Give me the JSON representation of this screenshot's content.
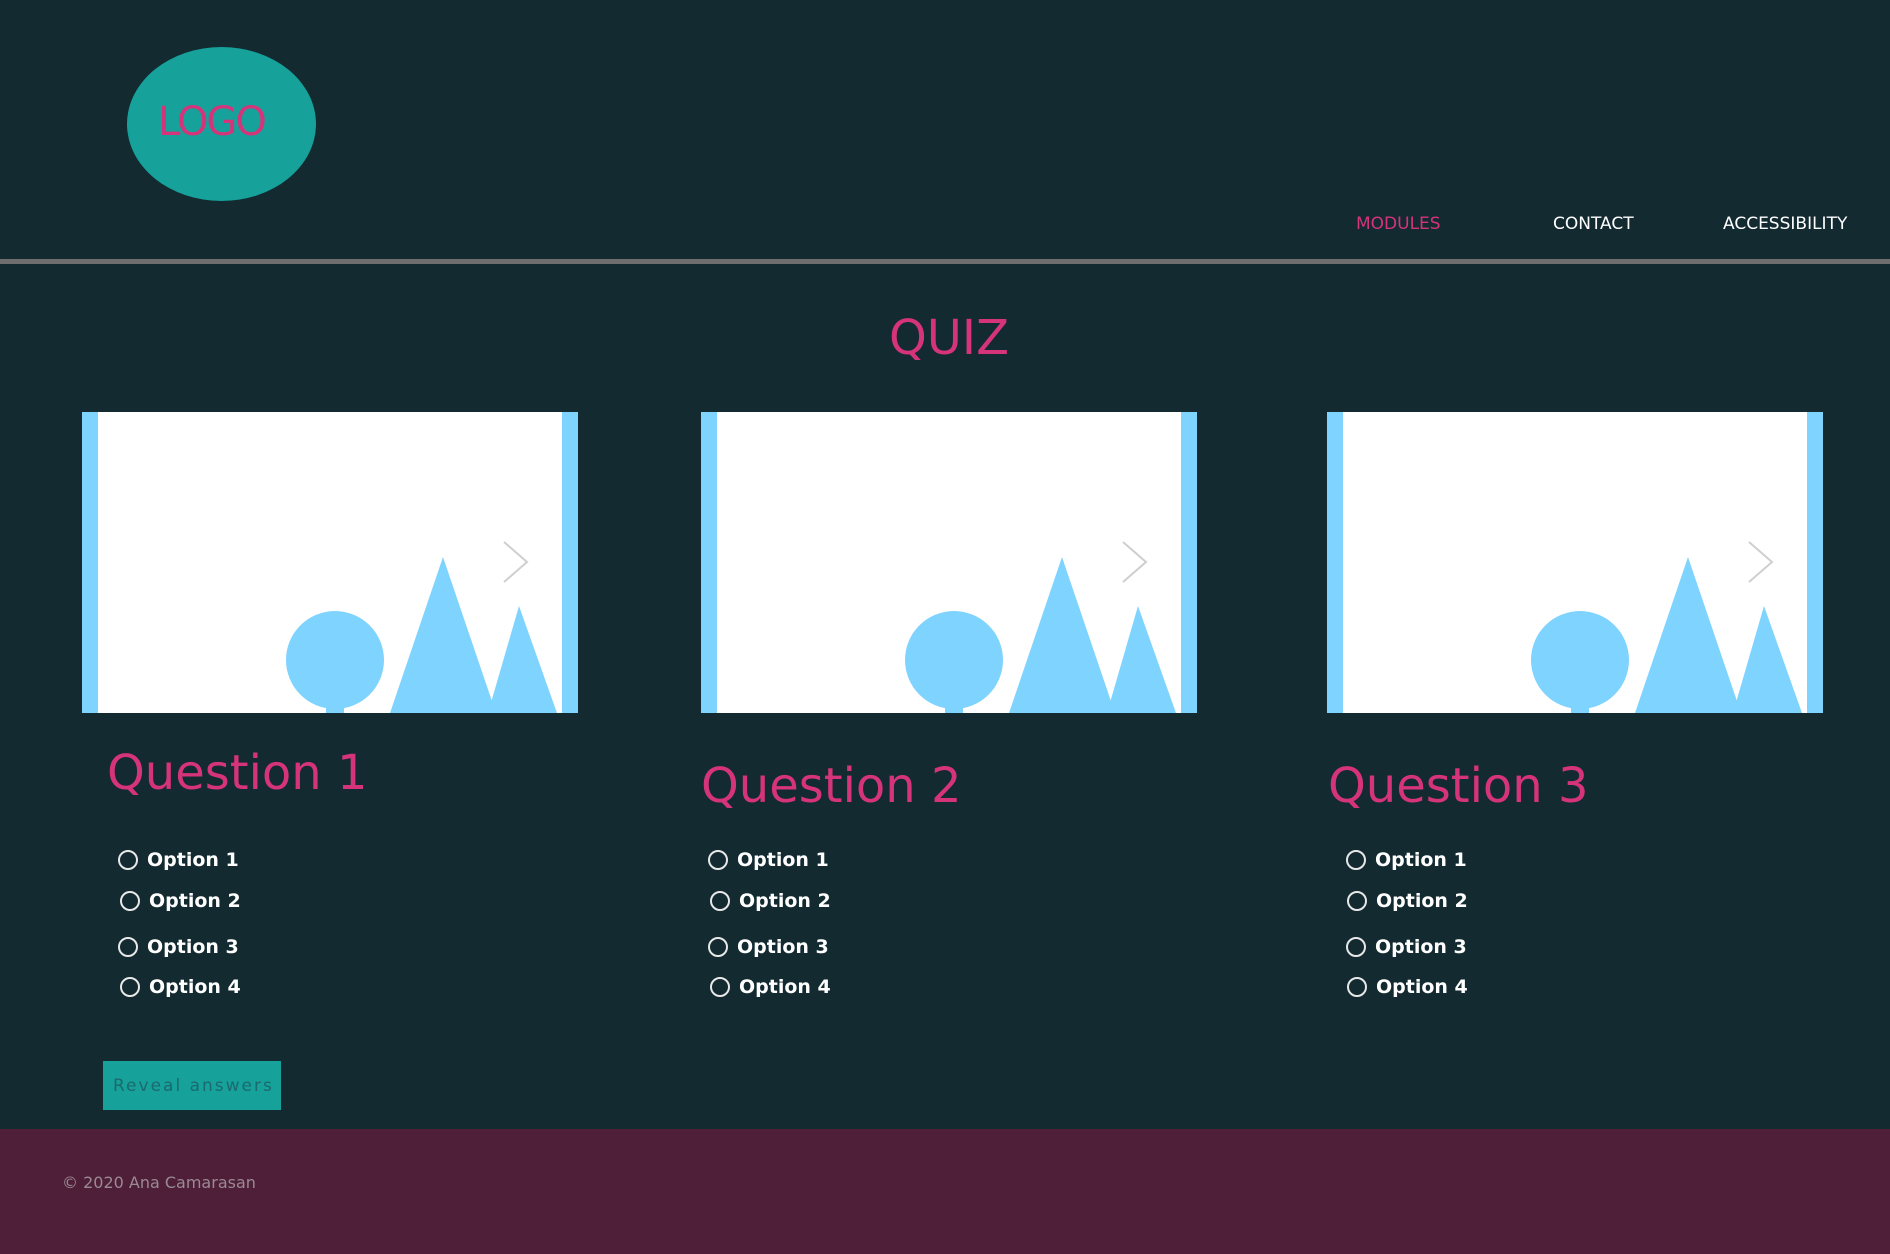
{
  "header": {
    "logo_text": "LOGO",
    "nav": [
      {
        "label": "MODULES",
        "active": true
      },
      {
        "label": "CONTACT",
        "active": false
      },
      {
        "label": "ACCESSIBILITY",
        "active": false
      }
    ]
  },
  "main": {
    "title": "QUIZ",
    "questions": [
      {
        "title": "Question 1",
        "image_icon": "image-placeholder-icon",
        "arrow_icon": "chevron-right-icon",
        "options": [
          "Option 1",
          "Option 2",
          "Option 3",
          "Option 4"
        ]
      },
      {
        "title": "Question 2",
        "image_icon": "image-placeholder-icon",
        "arrow_icon": "chevron-right-icon",
        "options": [
          "Option 1",
          "Option 2",
          "Option 3",
          "Option 4"
        ]
      },
      {
        "title": "Question 3",
        "image_icon": "image-placeholder-icon",
        "arrow_icon": "chevron-right-icon",
        "options": [
          "Option 1",
          "Option 2",
          "Option 3",
          "Option 4"
        ]
      }
    ],
    "reveal_button_label": "Reveal answers"
  },
  "footer": {
    "copyright": "© 2020 Ana Camarasan"
  },
  "colors": {
    "background": "#122a30",
    "accent_pink": "#d6347a",
    "teal": "#16a19a",
    "footer": "#4f1f3a",
    "placeholder_blue": "#7fd3ff"
  }
}
